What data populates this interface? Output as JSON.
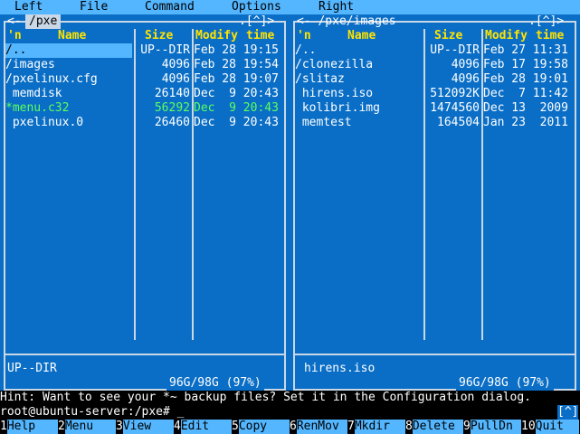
{
  "menu": [
    "Left",
    "File",
    "Command",
    "Options",
    "Right"
  ],
  "left_panel": {
    "path": "/pxe",
    "title_left": "<- ",
    "title_right": ".[^]>",
    "headers": {
      "n": "'n",
      "name": "Name",
      "size": "Size",
      "modify": "Modify",
      "time": "time"
    },
    "rows": [
      {
        "name": "/..",
        "size": "UP--DIR",
        "date": "Feb 28 19:15",
        "selected": true,
        "exec": false
      },
      {
        "name": "/images",
        "size": "4096",
        "date": "Feb 28 19:54",
        "selected": false,
        "exec": false
      },
      {
        "name": "/pxelinux.cfg",
        "size": "4096",
        "date": "Feb 28 19:07",
        "selected": false,
        "exec": false
      },
      {
        "name": " memdisk",
        "size": "26140",
        "date": "Dec  9 20:43",
        "selected": false,
        "exec": false
      },
      {
        "name": "*menu.c32",
        "size": "56292",
        "date": "Dec  9 20:43",
        "selected": false,
        "exec": true
      },
      {
        "name": " pxelinux.0",
        "size": "26460",
        "date": "Dec  9 20:43",
        "selected": false,
        "exec": false
      }
    ],
    "status": "UP--DIR",
    "disk": "96G/98G (97%)"
  },
  "right_panel": {
    "title": "<- /pxe/images",
    "title_right": ".[^]>",
    "headers": {
      "n": "'n",
      "name": "Name",
      "size": "Size",
      "modify": "Modify",
      "time": "time"
    },
    "rows": [
      {
        "name": "/..",
        "size": "UP--DIR",
        "date": "Feb 27 11:31"
      },
      {
        "name": "/clonezilla",
        "size": "4096",
        "date": "Feb 17 19:58"
      },
      {
        "name": "/slitaz",
        "size": "4096",
        "date": "Feb 28 19:01"
      },
      {
        "name": " hirens.iso",
        "size": "512092K",
        "date": "Dec  7 11:42"
      },
      {
        "name": " kolibri.img",
        "size": "1474560",
        "date": "Dec 13  2009"
      },
      {
        "name": " memtest",
        "size": "164504",
        "date": "Jan 23  2011"
      }
    ],
    "status": "hirens.iso",
    "disk": "96G/98G (97%)"
  },
  "hint": "Hint: Want to see your *~ backup files? Set it in the Configuration dialog.",
  "prompt": "root@ubuntu-server:/pxe# _",
  "prompt_right": "[^]",
  "fkeys": [
    {
      "num": "1",
      "label": "Help"
    },
    {
      "num": "2",
      "label": "Menu"
    },
    {
      "num": "3",
      "label": "View"
    },
    {
      "num": "4",
      "label": "Edit"
    },
    {
      "num": "5",
      "label": "Copy"
    },
    {
      "num": "6",
      "label": "RenMov"
    },
    {
      "num": "7",
      "label": "Mkdir"
    },
    {
      "num": "8",
      "label": "Delete"
    },
    {
      "num": "9",
      "label": "PullDn"
    },
    {
      "num": "10",
      "label": "Quit"
    }
  ]
}
